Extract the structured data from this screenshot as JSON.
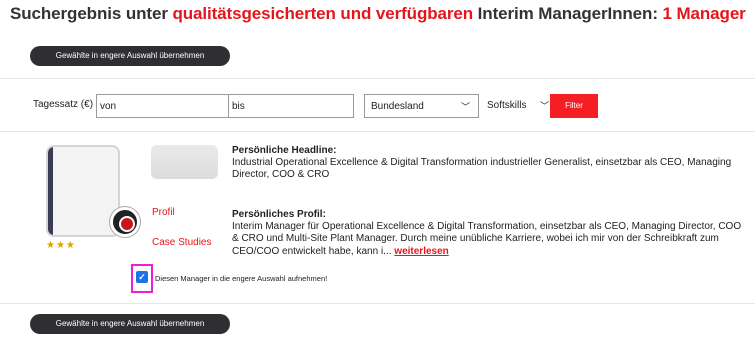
{
  "header": {
    "prefix": "Suchergebnis unter",
    "highlight": "qualitätsgesicherten und verfügbaren",
    "middle": "Interim ManagerInnen:",
    "count": "1 Manager"
  },
  "buttons": {
    "take_over_top": "Gewählte in engere Auswahl übernehmen",
    "take_over_bottom": "Gewählte in engere Auswahl übernehmen",
    "filter": "Filter"
  },
  "filters": {
    "tagessatz_label": "Tagessatz (€)",
    "von_value": "von",
    "bis_value": "bis",
    "bundesland_selected": "Bundesland",
    "softskills_selected": "Softskills"
  },
  "result": {
    "rating_stars": 3,
    "stars": "★★★",
    "links": {
      "profil": "Profil",
      "case_studies": "Case Studies"
    },
    "headline_title": "Persönliche Headline:",
    "headline_text": "Industrial Operational Excellence & Digital Transformation industrieller Generalist, einsetzbar als CEO, Managing Director, COO & CRO",
    "profile_title": "Persönliches Profil:",
    "profile_text": "Interim Manager für Operational Excellence & Digital Transformation, einsetzbar als CEO, Managing Director, COO & CRO und Multi-Site Plant Manager. Durch meine unübliche Karriere, wobei ich mir von der Schreibkraft zum CEO/COO entwickelt habe, kann i...",
    "read_more": "weiterlesen",
    "checkbox_checked": true,
    "checkbox_label": "Diesen Manager in die engere Auswahl aufnehmen!"
  },
  "colors": {
    "accent_red": "#e4161c",
    "button_dark": "#2f2f33",
    "checkbox_blue": "#1a73e8",
    "highlight_magenta": "#ec1fd6"
  },
  "icons": {
    "bundesland_chevron": "chevron-down-icon",
    "softskills_chevron": "chevron-down-icon",
    "checkbox": "checkmark-icon"
  }
}
